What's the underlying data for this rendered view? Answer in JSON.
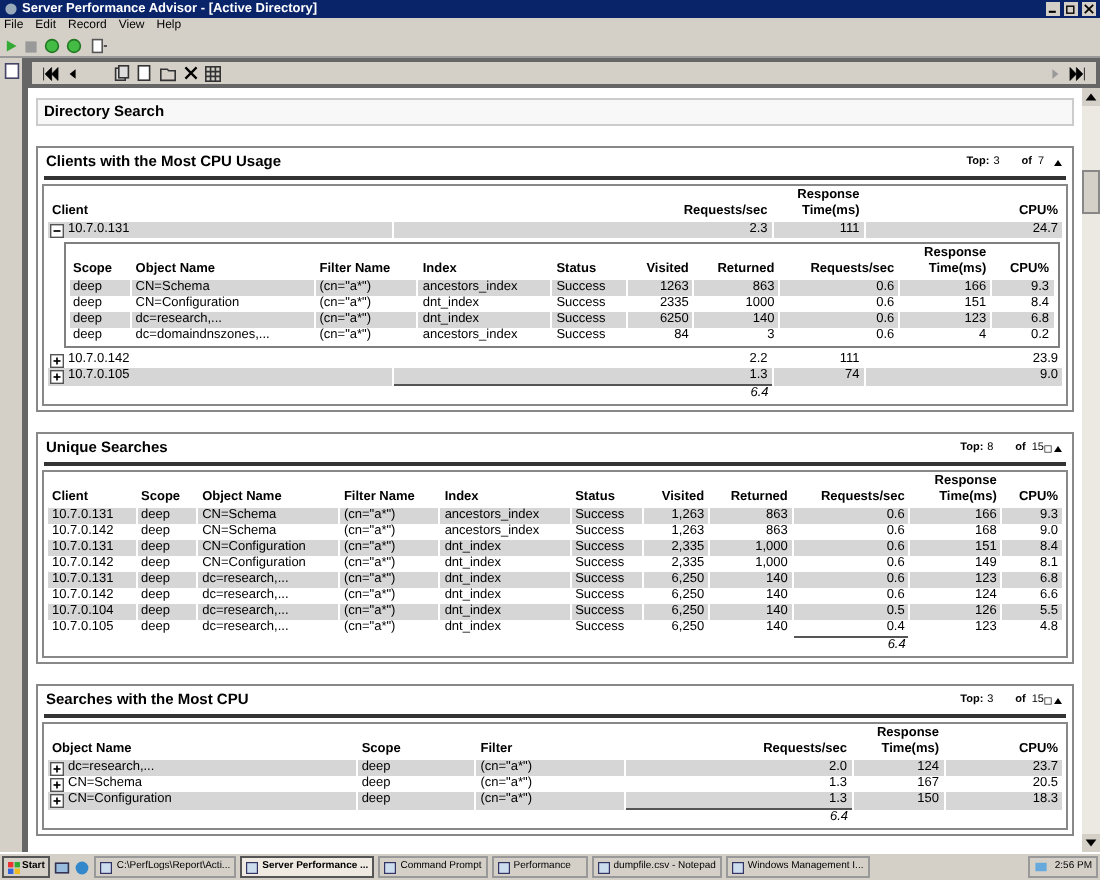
{
  "window": {
    "title": "Server Performance Advisor - [Active Directory]"
  },
  "menu": [
    "File",
    "Edit",
    "Record",
    "View",
    "Help"
  ],
  "report_title": "Directory Search",
  "sections": [
    {
      "title": "Clients with the Most CPU Usage",
      "top_label": "Top:",
      "top_value": "3",
      "of_label": "of",
      "of_value": "7",
      "export_icon": false,
      "columns": [
        {
          "label": "Client",
          "kind": "text"
        },
        {
          "label": "Requests/sec",
          "kind": "number"
        },
        {
          "label": "Response Time(ms)",
          "kind": "number"
        },
        {
          "label": "CPU%",
          "kind": "number"
        }
      ],
      "rows": [
        {
          "cells": [
            "10.7.0.131",
            "2.3",
            "111",
            "24.7"
          ],
          "expanded": true,
          "details": {
            "columns": [
              {
                "label": "Scope",
                "kind": "text"
              },
              {
                "label": "Object Name",
                "kind": "text"
              },
              {
                "label": "Filter Name",
                "kind": "text"
              },
              {
                "label": "Index",
                "kind": "text"
              },
              {
                "label": "Status",
                "kind": "text"
              },
              {
                "label": "Visited",
                "kind": "number"
              },
              {
                "label": "Returned",
                "kind": "number"
              },
              {
                "label": "Requests/sec",
                "kind": "number"
              },
              {
                "label": "Response Time(ms)",
                "kind": "number"
              },
              {
                "label": "CPU%",
                "kind": "number"
              }
            ],
            "rows": [
              {
                "cells": [
                  "deep",
                  "CN=Schema",
                  "(cn=\"a*\")",
                  "ancestors_index",
                  "Success",
                  "1263",
                  "863",
                  "0.6",
                  "166",
                  "9.3"
                ]
              },
              {
                "cells": [
                  "deep",
                  "CN=Configuration",
                  "(cn=\"a*\")",
                  "dnt_index",
                  "Success",
                  "2335",
                  "1000",
                  "0.6",
                  "151",
                  "8.4"
                ]
              },
              {
                "cells": [
                  "deep",
                  "dc=research,...",
                  "(cn=\"a*\")",
                  "dnt_index",
                  "Success",
                  "6250",
                  "140",
                  "0.6",
                  "123",
                  "6.8"
                ]
              },
              {
                "cells": [
                  "deep",
                  "dc=domaindnszones,...",
                  "(cn=\"a*\")",
                  "ancestors_index",
                  "Success",
                  "84",
                  "3",
                  "0.6",
                  "4",
                  "0.2"
                ]
              }
            ]
          }
        },
        {
          "cells": [
            "10.7.0.142",
            "2.2",
            "111",
            "23.9"
          ],
          "expanded": false
        },
        {
          "cells": [
            "10.7.0.105",
            "1.3",
            "74",
            "9.0"
          ],
          "expanded": false
        }
      ],
      "total": "6.4"
    },
    {
      "title": "Unique Searches",
      "top_label": "Top:",
      "top_value": "8",
      "of_label": "of",
      "of_value": "15",
      "export_icon": true,
      "columns": [
        {
          "label": "Client",
          "kind": "text"
        },
        {
          "label": "Scope",
          "kind": "text"
        },
        {
          "label": "Object Name",
          "kind": "text"
        },
        {
          "label": "Filter Name",
          "kind": "text"
        },
        {
          "label": "Index",
          "kind": "text"
        },
        {
          "label": "Status",
          "kind": "text"
        },
        {
          "label": "Visited",
          "kind": "number"
        },
        {
          "label": "Returned",
          "kind": "number"
        },
        {
          "label": "Requests/sec",
          "kind": "number"
        },
        {
          "label": "Response Time(ms)",
          "kind": "number"
        },
        {
          "label": "CPU%",
          "kind": "number"
        }
      ],
      "rows": [
        {
          "cells": [
            "10.7.0.131",
            "deep",
            "CN=Schema",
            "(cn=\"a*\")",
            "ancestors_index",
            "Success",
            "1,263",
            "863",
            "0.6",
            "166",
            "9.3"
          ]
        },
        {
          "cells": [
            "10.7.0.142",
            "deep",
            "CN=Schema",
            "(cn=\"a*\")",
            "ancestors_index",
            "Success",
            "1,263",
            "863",
            "0.6",
            "168",
            "9.0"
          ]
        },
        {
          "cells": [
            "10.7.0.131",
            "deep",
            "CN=Configuration",
            "(cn=\"a*\")",
            "dnt_index",
            "Success",
            "2,335",
            "1,000",
            "0.6",
            "151",
            "8.4"
          ]
        },
        {
          "cells": [
            "10.7.0.142",
            "deep",
            "CN=Configuration",
            "(cn=\"a*\")",
            "dnt_index",
            "Success",
            "2,335",
            "1,000",
            "0.6",
            "149",
            "8.1"
          ]
        },
        {
          "cells": [
            "10.7.0.131",
            "deep",
            "dc=research,...",
            "(cn=\"a*\")",
            "dnt_index",
            "Success",
            "6,250",
            "140",
            "0.6",
            "123",
            "6.8"
          ]
        },
        {
          "cells": [
            "10.7.0.142",
            "deep",
            "dc=research,...",
            "(cn=\"a*\")",
            "dnt_index",
            "Success",
            "6,250",
            "140",
            "0.6",
            "124",
            "6.6"
          ]
        },
        {
          "cells": [
            "10.7.0.104",
            "deep",
            "dc=research,...",
            "(cn=\"a*\")",
            "dnt_index",
            "Success",
            "6,250",
            "140",
            "0.5",
            "126",
            "5.5"
          ]
        },
        {
          "cells": [
            "10.7.0.105",
            "deep",
            "dc=research,...",
            "(cn=\"a*\")",
            "dnt_index",
            "Success",
            "6,250",
            "140",
            "0.4",
            "123",
            "4.8"
          ]
        }
      ],
      "total": "6.4"
    },
    {
      "title": "Searches with the Most CPU",
      "top_label": "Top:",
      "top_value": "3",
      "of_label": "of",
      "of_value": "15",
      "export_icon": true,
      "columns": [
        {
          "label": "Object Name",
          "kind": "text"
        },
        {
          "label": "Scope",
          "kind": "text"
        },
        {
          "label": "Filter",
          "kind": "text"
        },
        {
          "label": "Requests/sec",
          "kind": "number"
        },
        {
          "label": "Response Time(ms)",
          "kind": "number"
        },
        {
          "label": "CPU%",
          "kind": "number"
        }
      ],
      "rows": [
        {
          "cells": [
            "dc=research,...",
            "deep",
            "(cn=\"a*\")",
            "2.0",
            "124",
            "23.7"
          ],
          "expanded": false
        },
        {
          "cells": [
            "CN=Schema",
            "deep",
            "(cn=\"a*\")",
            "1.3",
            "167",
            "20.5"
          ],
          "expanded": false
        },
        {
          "cells": [
            "CN=Configuration",
            "deep",
            "(cn=\"a*\")",
            "1.3",
            "150",
            "18.3"
          ],
          "expanded": false
        }
      ],
      "total": "6.4"
    }
  ],
  "taskbar": {
    "start": "Start",
    "tasks": [
      {
        "label": "C:\\PerfLogs\\Report\\Acti...",
        "selected": false
      },
      {
        "label": "Server Performance ...",
        "selected": true
      },
      {
        "label": "Command Prompt",
        "selected": false
      },
      {
        "label": "Performance",
        "selected": false
      },
      {
        "label": "dumpfile.csv - Notepad",
        "selected": false
      },
      {
        "label": "Windows Management I...",
        "selected": false
      }
    ],
    "clock": "2:56 PM"
  }
}
